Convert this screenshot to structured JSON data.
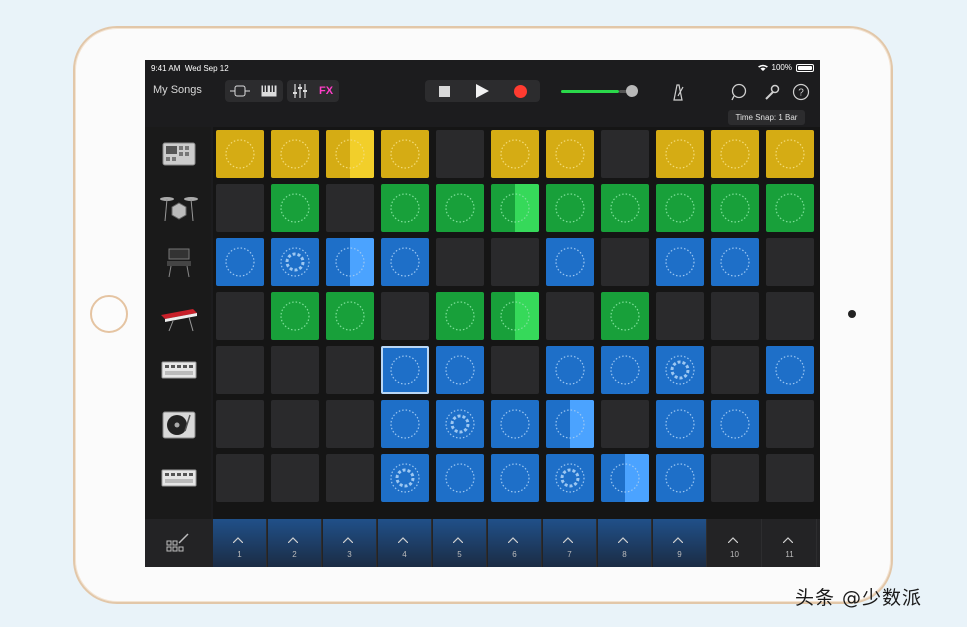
{
  "status": {
    "time": "9:41 AM",
    "date": "Wed Sep 12",
    "battery": "100%"
  },
  "toolbar": {
    "my_songs": "My Songs",
    "fx": "FX",
    "time_snap": "Time Snap: 1 Bar",
    "volume_level": 0.8
  },
  "instruments": [
    "drum-machine",
    "drum-kit",
    "keyboard-stand",
    "synth-keyboard",
    "sampler",
    "turntable",
    "sampler"
  ],
  "grid": [
    [
      "yellow",
      "yellow",
      "yellow-play",
      "yellow",
      "empty",
      "yellow",
      "yellow",
      "empty",
      "yellow",
      "yellow",
      "yellow"
    ],
    [
      "empty",
      "green",
      "empty",
      "green",
      "green",
      "green-play",
      "green",
      "green",
      "green",
      "green",
      "green"
    ],
    [
      "blue",
      "blue",
      "blue-play",
      "blue",
      "empty",
      "empty",
      "blue",
      "empty",
      "blue",
      "blue",
      "empty"
    ],
    [
      "empty",
      "green",
      "green",
      "empty",
      "green",
      "green-play",
      "empty",
      "green",
      "empty",
      "empty",
      "empty"
    ],
    [
      "empty",
      "empty",
      "empty",
      "blue-sel",
      "blue",
      "empty",
      "blue",
      "blue",
      "blue",
      "empty",
      "blue"
    ],
    [
      "empty",
      "empty",
      "empty",
      "blue",
      "blue",
      "blue",
      "blue-play",
      "empty",
      "blue",
      "blue",
      "empty"
    ],
    [
      "empty",
      "empty",
      "empty",
      "blue",
      "blue",
      "blue",
      "blue",
      "blue-play",
      "blue",
      "empty",
      "empty"
    ]
  ],
  "triggers": [
    "1",
    "2",
    "3",
    "4",
    "5",
    "6",
    "7",
    "8",
    "9",
    "10",
    "11"
  ],
  "active_triggers": 9,
  "watermark": "头条 @少数派",
  "colors": {
    "yellow": "#d5ac14",
    "green": "#18a03a",
    "blue": "#1e6fc8",
    "fx": "#ff3ec8",
    "record": "#ff3b30"
  }
}
